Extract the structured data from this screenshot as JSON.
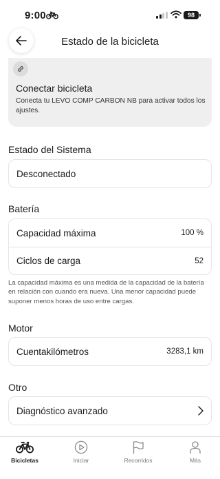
{
  "status_bar": {
    "time": "9:00",
    "battery_level": "98"
  },
  "header": {
    "title": "Estado de la bicicleta"
  },
  "connect_card": {
    "title": "Conectar bicicleta",
    "description": "Conecta tu LEVO COMP CARBON NB para activar todos los ajustes."
  },
  "system": {
    "section_title": "Estado del Sistema",
    "status": "Desconectado"
  },
  "battery": {
    "section_title": "Batería",
    "rows": [
      {
        "label": "Capacidad máxima",
        "value": "100 %"
      },
      {
        "label": "Ciclos de carga",
        "value": "52"
      }
    ],
    "note": "La capacidad máxima es una medida de la capacidad de la batería en relación con cuando era nueva. Una menor capacidad puede suponer menos horas de uso entre cargas."
  },
  "motor": {
    "section_title": "Motor",
    "rows": [
      {
        "label": "Cuentakilómetros",
        "value": "3283,1 km"
      }
    ]
  },
  "other": {
    "section_title": "Otro",
    "rows": [
      {
        "label": "Diagnóstico avanzado",
        "icon": "chevron-right-icon"
      }
    ]
  },
  "tab_bar": {
    "tabs": [
      {
        "label": "Bicicletas",
        "icon": "bike-icon",
        "active": true
      },
      {
        "label": "Iniciar",
        "icon": "play-icon",
        "active": false
      },
      {
        "label": "Recorridos",
        "icon": "flag-icon",
        "active": false
      },
      {
        "label": "Más",
        "icon": "person-icon",
        "active": false
      }
    ]
  },
  "colors": {
    "card_background": "#efefef",
    "border": "#e4e4e4",
    "text": "#1a1a1a"
  }
}
